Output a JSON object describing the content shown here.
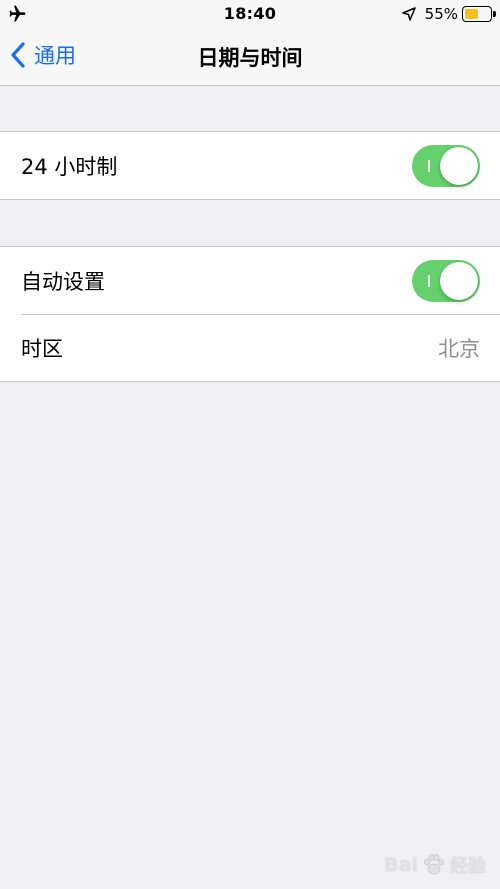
{
  "status_bar": {
    "left_icon": "airplane-icon",
    "time": "18:40",
    "location_icon": "location-arrow-icon",
    "battery_percent": "55%",
    "battery_level": 0.55,
    "battery_color": "#f5c022"
  },
  "nav": {
    "back_icon": "chevron-left-icon",
    "back_label": "通用",
    "title": "日期与时间",
    "accent_color": "#1a6cf0"
  },
  "settings": {
    "hour24": {
      "label": "24 小时制",
      "enabled": true
    },
    "auto_set": {
      "label": "自动设置",
      "enabled": true
    },
    "timezone": {
      "label": "时区",
      "value": "北京"
    }
  },
  "toggle_on_color": "#65d16c",
  "watermark": {
    "brand": "Bai",
    "icon": "paw-icon",
    "text": "经验"
  }
}
